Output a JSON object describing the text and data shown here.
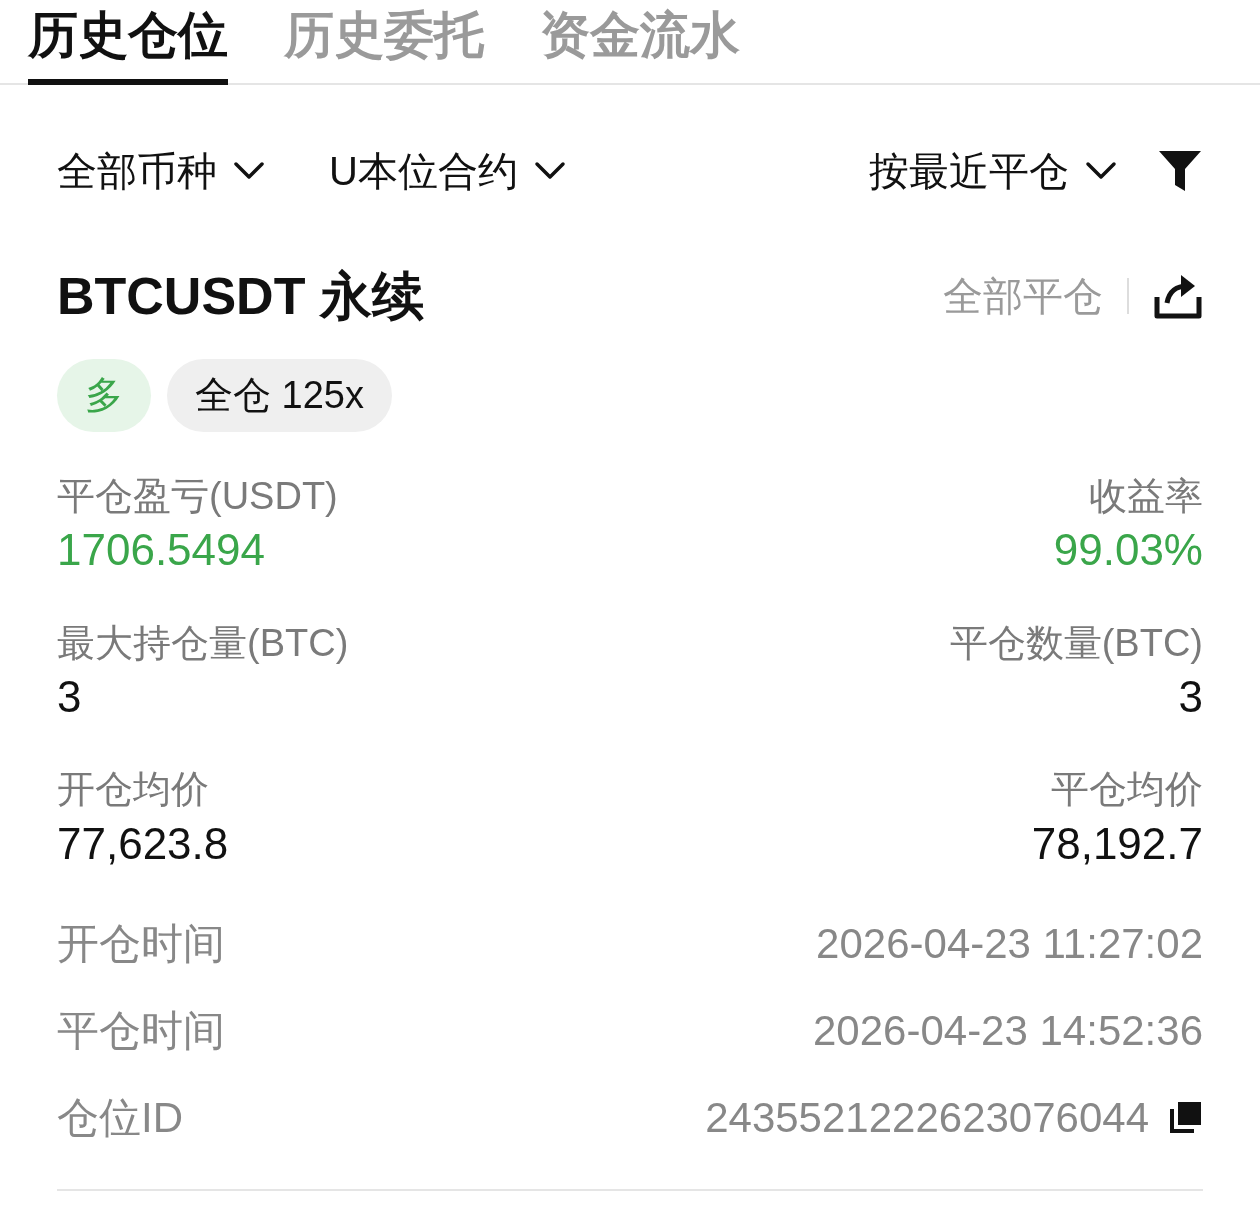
{
  "tabs": [
    {
      "label": "历史仓位",
      "selected": true
    },
    {
      "label": "历史委托",
      "selected": false
    },
    {
      "label": "资金流水",
      "selected": false
    }
  ],
  "filters": [
    {
      "label": "全部币种"
    },
    {
      "label": "U本位合约"
    }
  ],
  "sort": {
    "label": "按最近平仓"
  },
  "position": {
    "symbol": "BTCUSDT 永续",
    "close_all": "全部平仓",
    "tags": [
      {
        "label": "多",
        "kind": "long"
      },
      {
        "label": "全仓 125x",
        "kind": "neutral"
      }
    ],
    "stats": [
      {
        "left": {
          "label": "平仓盈亏(USDT)",
          "value": "1706.5494",
          "kind": "profit"
        },
        "right": {
          "label": "收益率",
          "value": "99.03%",
          "kind": "profit"
        }
      },
      {
        "left": {
          "label": "最大持仓量(BTC)",
          "value": "3",
          "kind": "plain"
        },
        "right": {
          "label": "平仓数量(BTC)",
          "value": "3",
          "kind": "plain"
        }
      },
      {
        "left": {
          "label": "开仓均价",
          "value": "77,623.8",
          "kind": "plain"
        },
        "right": {
          "label": "平仓均价",
          "value": "78,192.7",
          "kind": "plain"
        }
      }
    ],
    "details": [
      {
        "label": "开仓时间",
        "value": "2026-04-23 11:27:02",
        "copyable": false
      },
      {
        "label": "平仓时间",
        "value": "2026-04-23 14:52:36",
        "copyable": false
      },
      {
        "label": "仓位ID",
        "value": "2435521222623076044",
        "copyable": true
      }
    ]
  }
}
